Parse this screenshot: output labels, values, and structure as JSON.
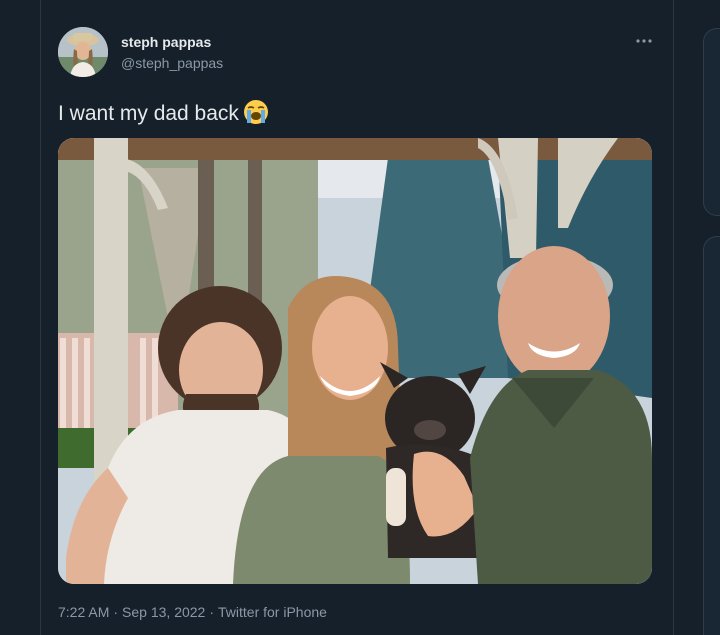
{
  "tweet": {
    "author": {
      "display_name": "steph pappas",
      "handle": "@steph_pappas",
      "avatar_icon": "profile-photo"
    },
    "more_icon": "more-horizontal-icon",
    "text": "I want my dad back",
    "emoji": "loudly-crying-face",
    "media": {
      "description_icon": "family-photo"
    },
    "meta": {
      "time": "7:22 AM",
      "date": "Sep 13, 2022",
      "separator": "·",
      "source": "Twitter for iPhone"
    }
  },
  "colors": {
    "background": "#15202b",
    "primary_text": "#e7e9ea",
    "secondary_text": "#8b98a5",
    "border": "#2a3743"
  }
}
